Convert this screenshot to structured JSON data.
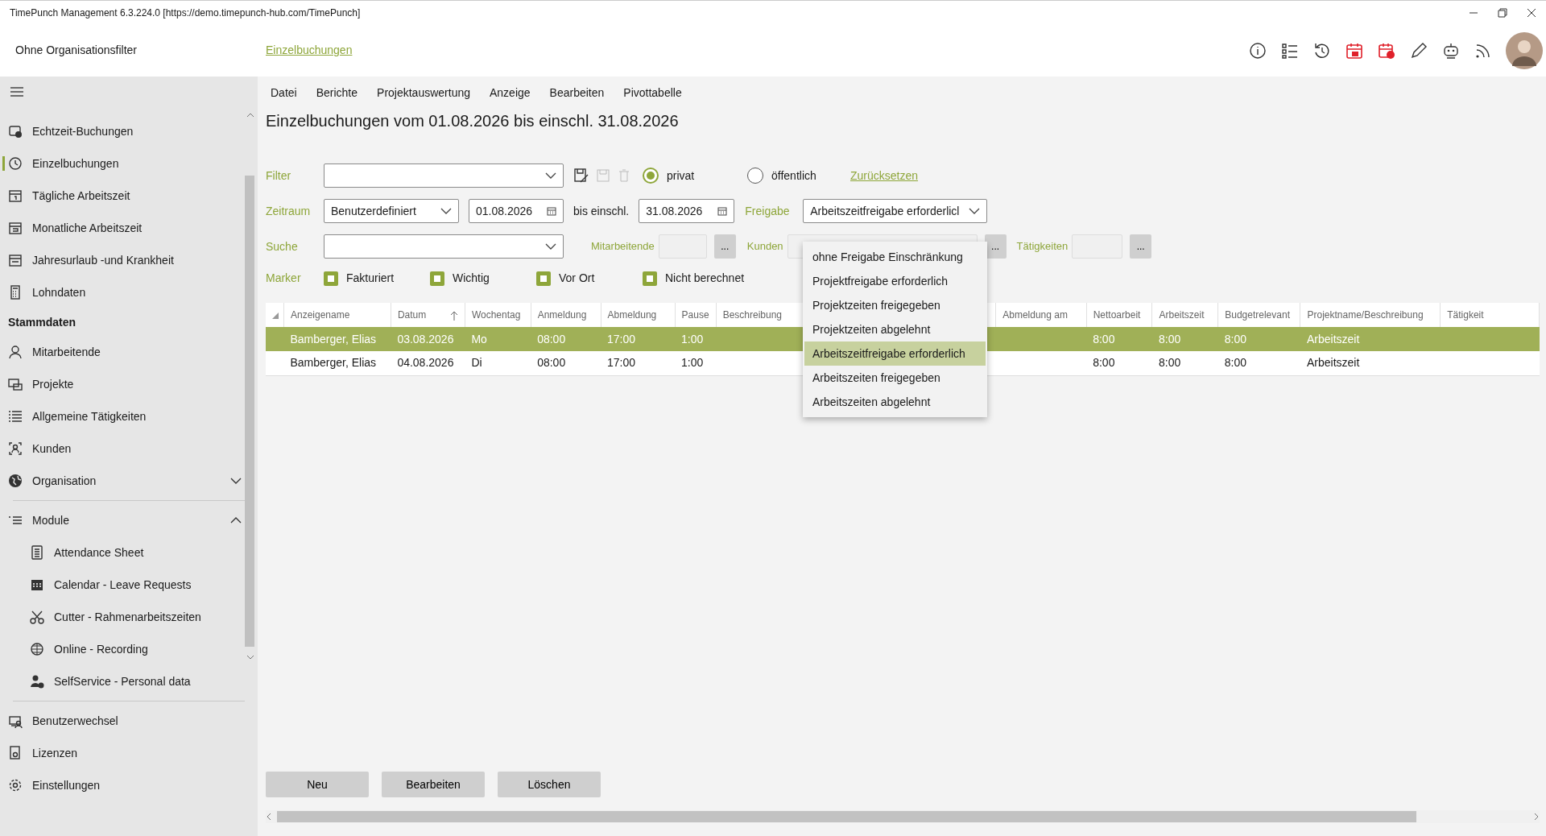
{
  "window": {
    "title": "TimePunch Management 6.3.224.0 [https://demo.timepunch-hub.com/TimePunch]"
  },
  "header": {
    "org_filter": "Ohne Organisationsfilter",
    "breadcrumb": "Einzelbuchungen"
  },
  "sidebar": {
    "groups": [
      {
        "items": [
          {
            "label": "Echtzeit-Buchungen",
            "selected": false
          },
          {
            "label": "Einzelbuchungen",
            "selected": true
          },
          {
            "label": "Tägliche Arbeitszeit",
            "selected": false
          },
          {
            "label": "Monatliche Arbeitszeit",
            "selected": false
          },
          {
            "label": "Jahresurlaub -und Krankheit",
            "selected": false
          },
          {
            "label": "Lohndaten",
            "selected": false
          }
        ]
      },
      {
        "heading": "Stammdaten",
        "items": [
          {
            "label": "Mitarbeitende",
            "selected": false
          },
          {
            "label": "Projekte",
            "selected": false
          },
          {
            "label": "Allgemeine Tätigkeiten",
            "selected": false
          },
          {
            "label": "Kunden",
            "selected": false
          },
          {
            "label": "Organisation",
            "selected": false,
            "expanded": false
          }
        ]
      },
      {
        "items": [
          {
            "label": "Module",
            "selected": false,
            "expanded": true,
            "children": [
              {
                "label": "Attendance Sheet"
              },
              {
                "label": "Calendar - Leave Requests"
              },
              {
                "label": "Cutter - Rahmenarbeitszeiten"
              },
              {
                "label": "Online - Recording"
              },
              {
                "label": "SelfService - Personal data"
              }
            ]
          }
        ]
      },
      {
        "items": [
          {
            "label": "Benutzerwechsel",
            "selected": false
          },
          {
            "label": "Lizenzen",
            "selected": false
          },
          {
            "label": "Einstellungen",
            "selected": false
          }
        ]
      }
    ]
  },
  "menu": [
    "Datei",
    "Berichte",
    "Projektauswertung",
    "Anzeige",
    "Bearbeiten",
    "Pivottabelle"
  ],
  "heading": "Einzelbuchungen vom 01.08.2026 bis einschl. 31.08.2026",
  "filter": {
    "label": "Filter",
    "visibility": [
      {
        "label": "privat",
        "selected": true
      },
      {
        "label": "öffentlich",
        "selected": false
      }
    ],
    "reset": "Zurücksetzen"
  },
  "period": {
    "label": "Zeitraum",
    "mode": "Benutzerdefiniert",
    "from": "01.08.2026",
    "until_label": "bis einschl.",
    "to": "31.08.2026",
    "approval_label": "Freigabe",
    "approval": "Arbeitszeitfreigabe erforderlicl"
  },
  "search": {
    "label": "Suche",
    "employees_label": "Mitarbeitende",
    "customers_label": "Kunden",
    "activities_label": "Tätigkeiten",
    "more": "..."
  },
  "markers": {
    "label": "Marker",
    "items": [
      {
        "label": "Fakturiert",
        "checked": true
      },
      {
        "label": "Wichtig",
        "checked": true
      },
      {
        "label": "Vor Ort",
        "checked": true
      },
      {
        "label": "Nicht berechnet",
        "checked": true
      }
    ]
  },
  "approval_options": [
    {
      "label": "ohne Freigabe Einschränkung",
      "selected": false
    },
    {
      "label": "Projektfreigabe erforderlich",
      "selected": false
    },
    {
      "label": "Projektzeiten freigegeben",
      "selected": false
    },
    {
      "label": "Projektzeiten abgelehnt",
      "selected": false
    },
    {
      "label": "Arbeitszeitfreigabe erforderlich",
      "selected": true
    },
    {
      "label": "Arbeitszeiten freigegeben",
      "selected": false
    },
    {
      "label": "Arbeitszeiten abgelehnt",
      "selected": false
    }
  ],
  "table": {
    "columns": [
      "Anzeigename",
      "Datum",
      "Wochentag",
      "Anmeldung",
      "Abmeldung",
      "Pause",
      "Beschreibung",
      "",
      "Abmeldung am",
      "Nettoarbeit",
      "Arbeitszeit",
      "Budgetrelevant",
      "Projektname/Beschreibung",
      "Tätigkeit"
    ],
    "rows": [
      {
        "selected": true,
        "cells": [
          "Bamberger, Elias",
          "03.08.2026",
          "Mo",
          "08:00",
          "17:00",
          "1:00",
          "",
          "",
          "",
          "8:00",
          "8:00",
          "8:00",
          "Arbeitszeit",
          ""
        ]
      },
      {
        "selected": false,
        "cells": [
          "Bamberger, Elias",
          "04.08.2026",
          "Di",
          "08:00",
          "17:00",
          "1:00",
          "",
          "",
          "",
          "8:00",
          "8:00",
          "8:00",
          "Arbeitszeit",
          ""
        ]
      }
    ]
  },
  "buttons": [
    "Neu",
    "Bearbeiten",
    "Löschen"
  ]
}
